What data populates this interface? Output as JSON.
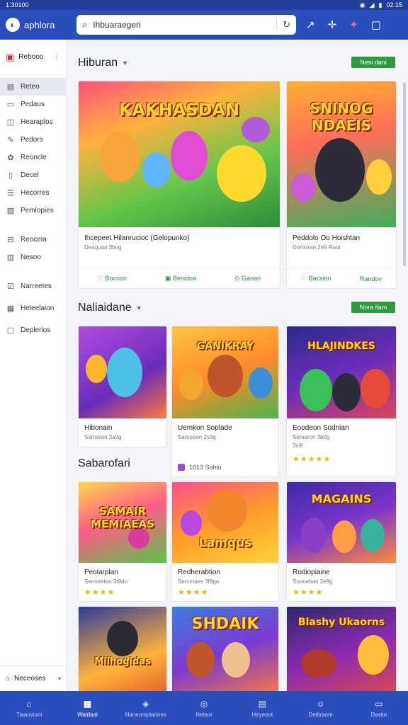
{
  "status": {
    "time": "1:30100",
    "clock": "02:15"
  },
  "appbar": {
    "brand": "aphlora",
    "search_value": "Ihbuaraegeri"
  },
  "sidebar": {
    "header": "Rebooo",
    "items": [
      {
        "label": "Reteo",
        "icon": "grid-icon"
      },
      {
        "label": "Pedaus",
        "icon": "doc-icon"
      },
      {
        "label": "Hearaplos",
        "icon": "chat-icon"
      },
      {
        "label": "Pedors",
        "icon": "pen-icon"
      },
      {
        "label": "Reoncle",
        "icon": "puzzle-icon"
      },
      {
        "label": "Decel",
        "icon": "file-icon"
      },
      {
        "label": "Hecorres",
        "icon": "list-icon"
      },
      {
        "label": "Pemlopies",
        "icon": "image-icon"
      },
      {
        "label": "Reocela",
        "icon": "lock-icon"
      },
      {
        "label": "Nesoo",
        "icon": "book-icon"
      },
      {
        "label": "Narreetes",
        "icon": "check-icon"
      },
      {
        "label": "Heleelaion",
        "icon": "clip-icon"
      },
      {
        "label": "Deplerlos",
        "icon": "tag-icon"
      }
    ],
    "footer": "Neceoses"
  },
  "sections": {
    "s1": {
      "title": "Hiburan",
      "button": "Nesi dani"
    },
    "s2": {
      "title": "Naliaidane",
      "button": "Nora ilam"
    },
    "s3": {
      "title": "Sabarofari"
    }
  },
  "featured": [
    {
      "art_text": "KAKHASDAN",
      "title": "Ihcepeet Hilanrucioc (Gelopunko)",
      "sub": "Deaquan 3bog",
      "actions": [
        "Bocrion",
        "Benidoa",
        "Ganari"
      ]
    },
    {
      "art_text": "SNINOG NDAEIS",
      "title": "Peddolo Oo Hoishtan",
      "sub": "Domoran 2e9 Roat",
      "actions": [
        "Bacsion",
        "Randov"
      ]
    }
  ],
  "row2": [
    {
      "title": "Hibonain",
      "sub": "Sumoran 3a9g",
      "art_text": ""
    },
    {
      "title": "Uemkon Soplade",
      "sub": "Sameeon 2s9g",
      "art_text": "GANIKRAY",
      "tag": "1013 Sohiu"
    },
    {
      "title": "Eoodeon Sodnian",
      "sub": "Semaron 3b9g",
      "sub2": "3s9I",
      "art_text": "HLAJINDKES",
      "stars": "★★★★★"
    }
  ],
  "row3": [
    {
      "title": "Peolarplan",
      "sub": "Senneetan 3t9do",
      "art_text": "SAMAIR MEMIAEAS",
      "stars": "★★★★"
    },
    {
      "title": "Redherabtion",
      "sub": "Semmaes 3f9go",
      "art_text": "Lamqus",
      "stars": "★★★★"
    },
    {
      "title": "Rodiopiaine",
      "sub": "Sooneban 2e9g",
      "art_text": "MAGAINS",
      "stars": "★★★★"
    }
  ],
  "row4": [
    {
      "art_text": "Milhogidas"
    },
    {
      "art_text": "SHDAIK"
    },
    {
      "art_text": "Blashy Ukaorns"
    }
  ],
  "bottomnav": [
    {
      "label": "Tiaaovioni",
      "icon": "home-icon"
    },
    {
      "label": "Waldaal",
      "icon": "apps-icon"
    },
    {
      "label": "Naneomplarines",
      "icon": "games-icon"
    },
    {
      "label": "Neinor",
      "icon": "compass-icon"
    },
    {
      "label": "Heyeoot",
      "icon": "calendar-icon"
    },
    {
      "label": "Deitiraom",
      "icon": "user-icon"
    },
    {
      "label": "Dastie",
      "icon": "cart-icon"
    }
  ],
  "colors": {
    "primary": "#2a4fbd",
    "accent": "#2e9a3e",
    "star": "#f2b90c"
  }
}
